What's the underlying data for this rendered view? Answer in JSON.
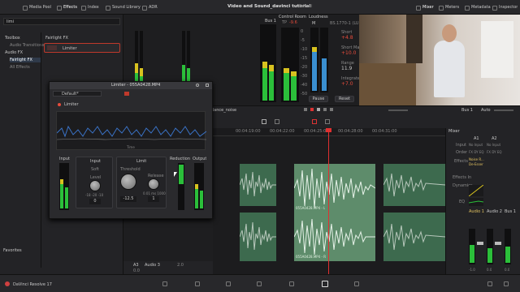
{
  "topbar": {
    "tabs": [
      "Media Pool",
      "Effects",
      "Index",
      "Sound Library",
      "ADR"
    ],
    "project_title": "Video and Sound_davinci tutorial",
    "project_status": "Edited",
    "right_tabs": [
      "Mixer",
      "Meters",
      "Metadata",
      "Inspector"
    ]
  },
  "left_panel": {
    "search": "limi",
    "tree": [
      "Toolbox",
      "Audio Transitions",
      "Audio FX",
      "Fairlight FX",
      "All Effects"
    ],
    "category_header": "Fairlight FX",
    "result_item": "Limiter",
    "favorites": "Favorites"
  },
  "meter_panel": {
    "bus1": "Bus 1",
    "control_room": "Control Room",
    "tp": "TP",
    "tp_value": "-9.6",
    "m_label": "M",
    "loudness": "Loudness",
    "loudness_std": "BS.1770-1 (LU)",
    "short_label": "Short",
    "short_value": "+4.8",
    "short_max_label": "Short Max",
    "short_max_value": "+10.0",
    "range_label": "Range",
    "range_value": "11.9",
    "integrated_label": "Integrated",
    "integrated_value": "+7.0",
    "pause_button": "Pause",
    "reset_button": "Reset",
    "scale": [
      "0",
      "-5",
      "-10",
      "-15",
      "-20",
      "-30",
      "-40",
      "-50"
    ]
  },
  "limiter": {
    "title": "Limiter - 055A0428.MP4",
    "preset": "Default*",
    "name": "Limiter",
    "graph_label": "Time",
    "input_label": "Input",
    "reduction_label": "Reduction",
    "output_label": "Output",
    "input_section": "Input",
    "soft_label": "Soft",
    "level_label": "Level",
    "level_scale": "-18  -20  -10",
    "level_value": "0",
    "limit_section": "Limit",
    "threshold_label": "Threshold",
    "threshold_value": "-12.5",
    "release_label": "Release",
    "release_scale": "0.01  ms  1000",
    "release_value": "1"
  },
  "timeline": {
    "clip_label": "dance_noise",
    "timecodes": [
      "00:04:19:00",
      "00:04:22:00",
      "00:04:25:00",
      "00:04:28:00",
      "00:04:31:00"
    ],
    "clip_names": [
      "055A0428.MP4 - L",
      "055A0428.MP4 - R"
    ],
    "track_name": "A3",
    "track_label": "Audio 3",
    "track_value": "2.0",
    "track_gain": "0.0",
    "bus": "Bus 1",
    "auto": "Auto"
  },
  "mixer": {
    "title": "Mixer",
    "channels": [
      "A1",
      "A2"
    ],
    "rows": [
      "Input",
      "Order",
      "Effects",
      "Effects In",
      "Dynamics",
      "EQ"
    ],
    "input_values": [
      "No Input",
      "No Input"
    ],
    "order_values": [
      "FX DY EQ",
      "FX DY EQ"
    ],
    "effects_value": "Noise R...",
    "effects_value2": "De-Esser",
    "bottom_labels": [
      "Audio 1",
      "Audio 2",
      "Bus 1"
    ],
    "bottom_values": [
      "-1.0",
      "0.0",
      "0.0"
    ]
  },
  "bottombar": {
    "app_name": "DaVinci Resolve 17"
  }
}
